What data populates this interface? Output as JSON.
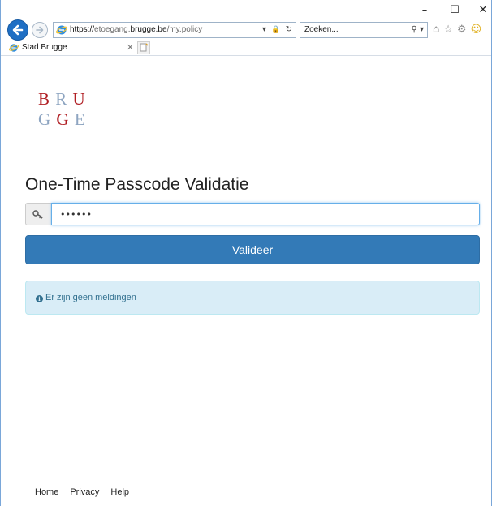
{
  "window": {
    "minimize_glyph": "–",
    "maximize_glyph": "☐",
    "close_glyph": "✕"
  },
  "navbar": {
    "url_scheme": "https://",
    "url_subdomain": "etoegang.",
    "url_host": "brugge.be",
    "url_path": "/my.policy",
    "address_icons": [
      "▾",
      "🔒",
      "↻"
    ],
    "search_placeholder": "Zoeken...",
    "search_icon_glyph": "⚲",
    "search_dropdown_glyph": "▾",
    "toolbar_icons": [
      "⌂",
      "☆",
      "⚙",
      "☺"
    ]
  },
  "tabs": [
    {
      "title": "Stad Brugge",
      "close_glyph": "✕"
    }
  ],
  "logo": {
    "row1": [
      "B",
      "R",
      "U"
    ],
    "row2": [
      "G",
      "G",
      "E"
    ],
    "dark_color": "#b01e23",
    "light_color": "#8ea5c1"
  },
  "page": {
    "title": "One-Time Passcode Validatie",
    "passcode_value": "••••••",
    "submit_label": "Valideer",
    "info_glyph": "i",
    "alert_text": "Er zijn geen meldingen",
    "accent_color": "#337ab7",
    "alert_bg_color": "#d9edf7"
  },
  "footer": {
    "links": [
      "Home",
      "Privacy",
      "Help"
    ]
  }
}
